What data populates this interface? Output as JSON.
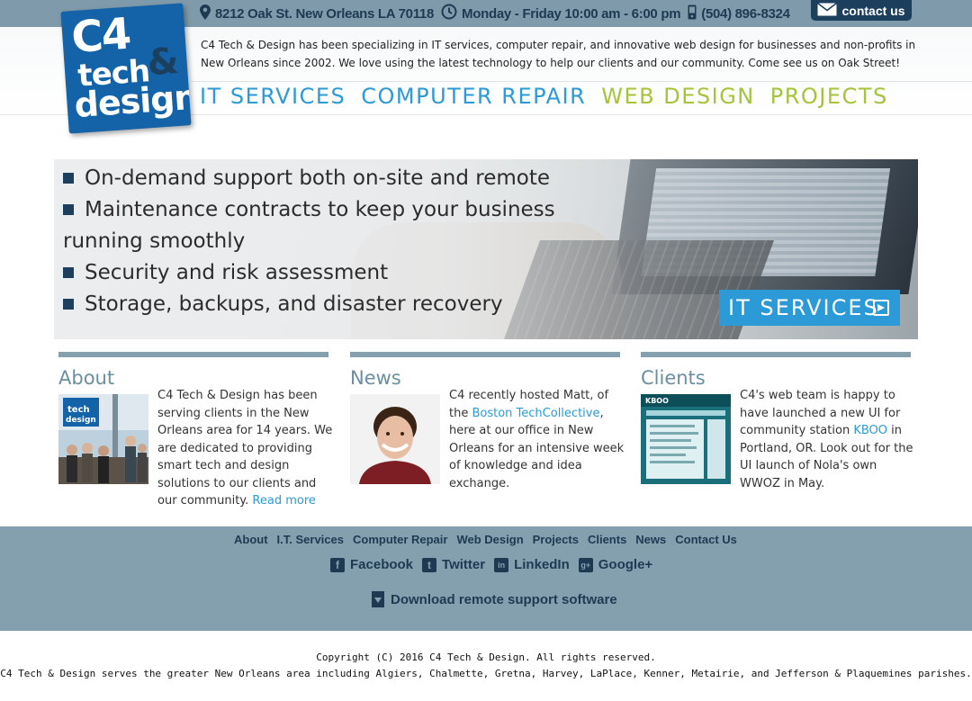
{
  "topbar": {
    "address": "8212 Oak St. New Orleans LA 70118",
    "hours": "Monday - Friday 10:00 am - 6:00 pm",
    "phone": "(504) 896-8324",
    "contact_label": "contact us"
  },
  "logo": {
    "line1": "C4",
    "line2": "tech",
    "amp": "&",
    "line3": "design"
  },
  "intro": "C4 Tech & Design has been specializing in IT services, computer repair, and innovative web design for businesses and non-profits in New Orleans since 2002. We love using the latest technology to help our clients and our community. Come see us on Oak Street!",
  "nav": [
    {
      "label": "IT SERVICES",
      "color": "#2b9ad6"
    },
    {
      "label": "COMPUTER REPAIR",
      "color": "#2b9ad6"
    },
    {
      "label": "WEB DESIGN",
      "color": "#a5c43a"
    },
    {
      "label": "PROJECTS",
      "color": "#a5c43a"
    }
  ],
  "hero": {
    "bullets": [
      "On-demand support both on-site and remote",
      "Maintenance contracts to keep your business running smoothly",
      "Security and risk assessment",
      "Storage, backups, and disaster recovery"
    ],
    "button_label": "IT SERVICES"
  },
  "columns": {
    "about": {
      "title": "About",
      "text": "C4 Tech & Design has been serving clients in the New Orleans area for 14 years. We are dedicated to providing smart tech and design solutions to our clients and our community.",
      "link": "Read more"
    },
    "news": {
      "title": "News",
      "text_before": "C4 recently hosted Matt, of the",
      "link": "Boston TechCollective",
      "text_after": ", here at our office in New Orleans for an intensive week of knowledge and idea exchange."
    },
    "clients": {
      "title": "Clients",
      "text_before": "C4's web team is happy to have launched a new UI for community station",
      "link": "KBOO",
      "text_after": "in Portland, OR. Look out for the UI launch of Nola's own WWOZ in May."
    }
  },
  "footer": {
    "nav": [
      "About",
      "I.T. Services",
      "Computer Repair",
      "Web Design",
      "Projects",
      "Clients",
      "News",
      "Contact Us"
    ],
    "social": [
      {
        "label": "Facebook",
        "icon": "facebook-icon",
        "glyph": "f"
      },
      {
        "label": "Twitter",
        "icon": "twitter-icon",
        "glyph": "t"
      },
      {
        "label": "LinkedIn",
        "icon": "linkedin-icon",
        "glyph": "in"
      },
      {
        "label": "Google+",
        "icon": "google-plus-icon",
        "glyph": "g+"
      }
    ],
    "download": "Download remote support software"
  },
  "copyright": "Copyright (C) 2016 C4 Tech & Design. All rights reserved.",
  "service_area": "C4 Tech & Design serves the greater New Orleans area including Algiers, Chalmette, Gretna, Harvey, LaPlace, Kenner, Metairie, and Jefferson & Plaquemines parishes.",
  "colors": {
    "brand_blue": "#1462a8",
    "navy": "#1d3a52",
    "accent_blue": "#2b9ad6",
    "accent_green": "#a5c43a",
    "slate": "#84a0af"
  }
}
